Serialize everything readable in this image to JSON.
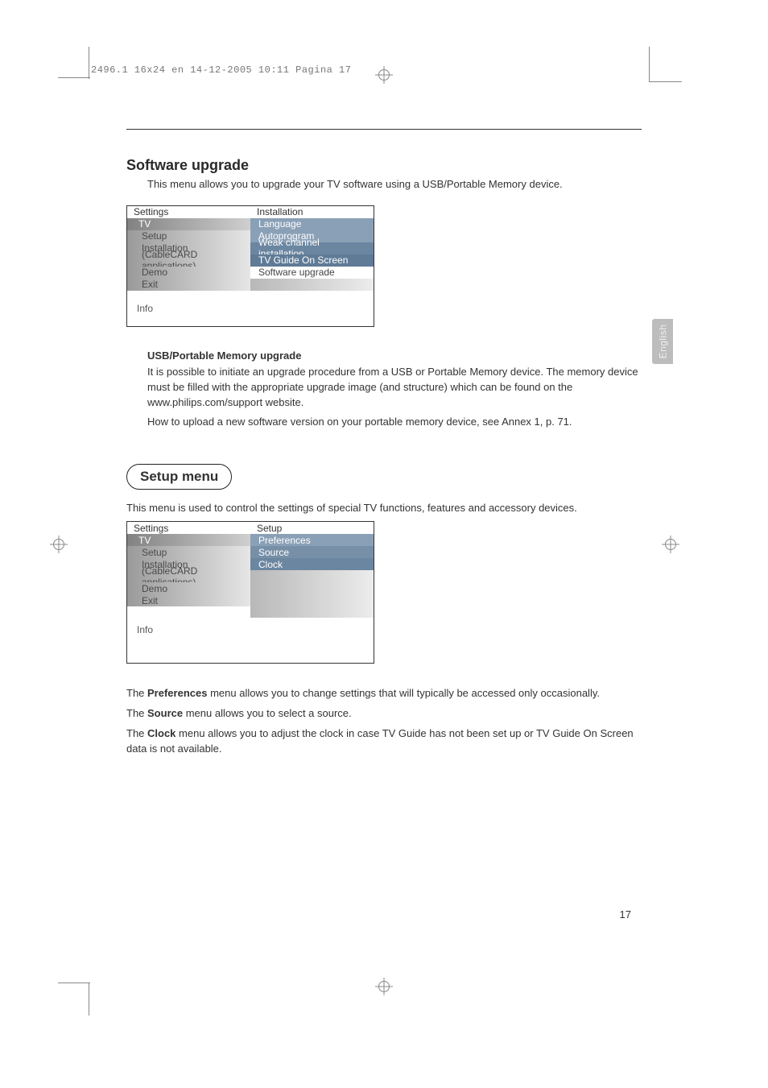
{
  "running_head": "2496.1 16x24 en  14-12-2005  10:11  Pagina 17",
  "side_tab": "English",
  "page_number": "17",
  "section1": {
    "title": "Software upgrade",
    "lead": "This menu allows you to upgrade your TV software using a USB/Portable Memory device.",
    "menu": {
      "left_header": "Settings",
      "right_header": "Installation",
      "left_items": [
        "TV",
        "Setup",
        "Installation",
        "(CableCARD applications)",
        "Demo",
        "Exit"
      ],
      "right_items": [
        "Language",
        "Autoprogram",
        "Weak channel installation",
        "TV Guide On Screen",
        "Software upgrade"
      ],
      "info": "Info"
    },
    "sub_heading": "USB/Portable Memory upgrade",
    "para1": "It is possible to initiate an upgrade procedure from a USB or Portable Memory device. The memory device must be filled with the appropriate upgrade image (and structure) which can be found on the www.philips.com/support website.",
    "para2": "How to upload a new software version on your portable memory device, see Annex 1, p. 71."
  },
  "section2": {
    "title": "Setup menu",
    "lead": "This menu is used to control the settings of special TV functions, features and accessory devices.",
    "menu": {
      "left_header": "Settings",
      "right_header": "Setup",
      "left_items": [
        "TV",
        "Setup",
        "Installation",
        "(CableCARD applications)",
        "Demo",
        "Exit"
      ],
      "right_items": [
        "Preferences",
        "Source",
        "Clock"
      ],
      "info": "Info"
    },
    "p_pref_a": "The ",
    "p_pref_b": "Preferences",
    "p_pref_c": " menu allows you to change settings that will typically be accessed only occasionally.",
    "p_src_a": "The ",
    "p_src_b": "Source",
    "p_src_c": " menu allows you to select a source.",
    "p_clk_a": "The ",
    "p_clk_b": "Clock",
    "p_clk_c": " menu allows you to adjust the clock in case TV Guide has not been set up or TV Guide On Screen data is not available."
  }
}
